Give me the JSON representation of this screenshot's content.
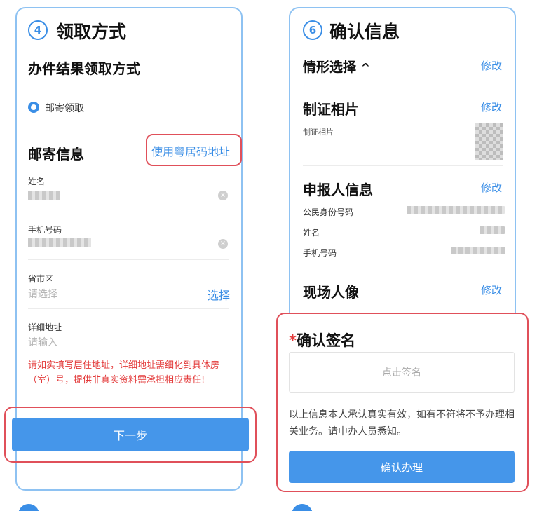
{
  "left": {
    "step_number": "4",
    "step_title": "领取方式",
    "result_section_title": "办件结果领取方式",
    "pickup_option": "邮寄领取",
    "mail_section_title": "邮寄信息",
    "use_address_link": "使用粤居码地址",
    "fields": {
      "name_label": "姓名",
      "phone_label": "手机号码",
      "region_label": "省市区",
      "region_placeholder": "请选择",
      "region_select": "选择",
      "address_label": "详细地址",
      "address_placeholder": "请输入"
    },
    "notice": "请如实填写居住地址，详细地址需细化到具体房（室）号，提供非真实资料需承担相应责任!",
    "next_button": "下一步"
  },
  "right": {
    "step_number": "6",
    "step_title": "确认信息",
    "edit_label": "修改",
    "situation_title": "情形选择",
    "photo_title": "制证相片",
    "photo_label": "制证相片",
    "applicant_title": "申报人信息",
    "id_label": "公民身份号码",
    "name_label": "姓名",
    "phone_label": "手机号码",
    "portrait_title": "现场人像",
    "signature_required_mark": "*",
    "signature_title": "确认签名",
    "signature_placeholder": "点击签名",
    "declaration": "以上信息本人承认真实有效，如有不符将不予办理相关业务。请申办人员悉知。",
    "confirm_button": "确认办理"
  },
  "colors": {
    "accent": "#3a8ee6",
    "button": "#4596ea",
    "highlight": "#e0505a",
    "notice": "#e33a3a"
  }
}
